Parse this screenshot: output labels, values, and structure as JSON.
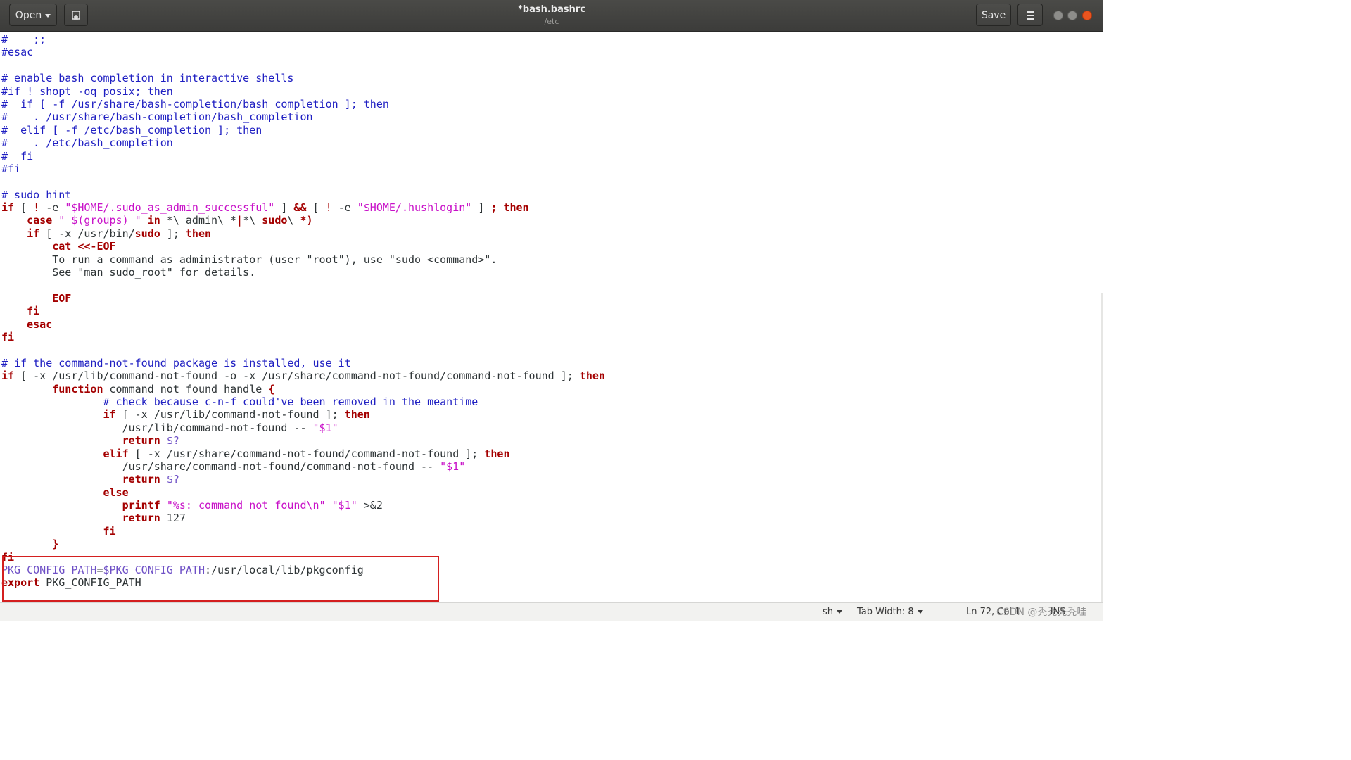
{
  "header": {
    "open_label": "Open",
    "new_icon": "new-document-icon",
    "title": "*bash.bashrc",
    "subtitle": "/etc",
    "save_label": "Save",
    "menu_icon": "hamburger-menu-icon"
  },
  "editor": {
    "language": "sh",
    "lines": [
      [
        [
          "c",
          "#    ;;"
        ]
      ],
      [
        [
          "c",
          "#esac"
        ]
      ],
      [
        [
          "p",
          ""
        ]
      ],
      [
        [
          "c",
          "# enable bash completion in interactive shells"
        ]
      ],
      [
        [
          "c",
          "#if ! shopt -oq posix; then"
        ]
      ],
      [
        [
          "c",
          "#  if [ -f /usr/share/bash-completion/bash_completion ]; then"
        ]
      ],
      [
        [
          "c",
          "#    . /usr/share/bash-completion/bash_completion"
        ]
      ],
      [
        [
          "c",
          "#  elif [ -f /etc/bash_completion ]; then"
        ]
      ],
      [
        [
          "c",
          "#    . /etc/bash_completion"
        ]
      ],
      [
        [
          "c",
          "#  fi"
        ]
      ],
      [
        [
          "c",
          "#fi"
        ]
      ],
      [
        [
          "p",
          ""
        ]
      ],
      [
        [
          "c",
          "# sudo hint"
        ]
      ],
      [
        [
          "k",
          "if"
        ],
        [
          "p",
          " [ "
        ],
        [
          "o",
          "!"
        ],
        [
          "p",
          " -e "
        ],
        [
          "s",
          "\"$HOME/.sudo_as_admin_successful\""
        ],
        [
          "p",
          " ] "
        ],
        [
          "k",
          "&&"
        ],
        [
          "p",
          " [ "
        ],
        [
          "o",
          "!"
        ],
        [
          "p",
          " -e "
        ],
        [
          "s",
          "\"$HOME/.hushlogin\""
        ],
        [
          "p",
          " ] "
        ],
        [
          "k",
          "; then"
        ]
      ],
      [
        [
          "p",
          "    "
        ],
        [
          "k",
          "case"
        ],
        [
          "p",
          " "
        ],
        [
          "s",
          "\" $(groups) \""
        ],
        [
          "p",
          " "
        ],
        [
          "k",
          "in"
        ],
        [
          "p",
          " *\\ admin\\ *"
        ],
        [
          "o",
          "|"
        ],
        [
          "p",
          "*\\ "
        ],
        [
          "k",
          "sudo"
        ],
        [
          "p",
          "\\ "
        ],
        [
          "k",
          "*)"
        ]
      ],
      [
        [
          "p",
          "    "
        ],
        [
          "k",
          "if"
        ],
        [
          "p",
          " [ -x /usr/bin/"
        ],
        [
          "k",
          "sudo"
        ],
        [
          "p",
          " ]; "
        ],
        [
          "k",
          "then"
        ]
      ],
      [
        [
          "p",
          "        "
        ],
        [
          "k",
          "cat <<-EOF"
        ]
      ],
      [
        [
          "p",
          "        To run a command as administrator (user \"root\"), use \"sudo <command>\"."
        ]
      ],
      [
        [
          "p",
          "        See \"man sudo_root\" for details."
        ]
      ],
      [
        [
          "p",
          ""
        ]
      ],
      [
        [
          "p",
          "        "
        ],
        [
          "k",
          "EOF"
        ]
      ],
      [
        [
          "p",
          "    "
        ],
        [
          "k",
          "fi"
        ]
      ],
      [
        [
          "p",
          "    "
        ],
        [
          "k",
          "esac"
        ]
      ],
      [
        [
          "k",
          "fi"
        ]
      ],
      [
        [
          "p",
          ""
        ]
      ],
      [
        [
          "c",
          "# if the command-not-found package is installed, use it"
        ]
      ],
      [
        [
          "k",
          "if"
        ],
        [
          "p",
          " [ -x /usr/lib/command-not-found -o -x /usr/share/command-not-found/command-not-found ]; "
        ],
        [
          "k",
          "then"
        ]
      ],
      [
        [
          "p",
          "        "
        ],
        [
          "k",
          "function"
        ],
        [
          "p",
          " command_not_found_handle "
        ],
        [
          "k",
          "{"
        ]
      ],
      [
        [
          "p",
          "                "
        ],
        [
          "c",
          "# check because c-n-f could've been removed in the meantime"
        ]
      ],
      [
        [
          "p",
          "                "
        ],
        [
          "k",
          "if"
        ],
        [
          "p",
          " [ -x /usr/lib/command-not-found ]; "
        ],
        [
          "k",
          "then"
        ]
      ],
      [
        [
          "p",
          "                   /usr/lib/command-not-found -- "
        ],
        [
          "s",
          "\"$1\""
        ]
      ],
      [
        [
          "p",
          "                   "
        ],
        [
          "k",
          "return"
        ],
        [
          "p",
          " "
        ],
        [
          "v",
          "$?"
        ]
      ],
      [
        [
          "p",
          "                "
        ],
        [
          "k",
          "elif"
        ],
        [
          "p",
          " [ -x /usr/share/command-not-found/command-not-found ]; "
        ],
        [
          "k",
          "then"
        ]
      ],
      [
        [
          "p",
          "                   /usr/share/command-not-found/command-not-found -- "
        ],
        [
          "s",
          "\"$1\""
        ]
      ],
      [
        [
          "p",
          "                   "
        ],
        [
          "k",
          "return"
        ],
        [
          "p",
          " "
        ],
        [
          "v",
          "$?"
        ]
      ],
      [
        [
          "p",
          "                "
        ],
        [
          "k",
          "else"
        ]
      ],
      [
        [
          "p",
          "                   "
        ],
        [
          "k",
          "printf"
        ],
        [
          "p",
          " "
        ],
        [
          "s",
          "\"%s: command not found\\n\""
        ],
        [
          "p",
          " "
        ],
        [
          "s",
          "\"$1\""
        ],
        [
          "p",
          " >&2"
        ]
      ],
      [
        [
          "p",
          "                   "
        ],
        [
          "k",
          "return"
        ],
        [
          "p",
          " 127"
        ]
      ],
      [
        [
          "p",
          "                "
        ],
        [
          "k",
          "fi"
        ]
      ],
      [
        [
          "p",
          "        "
        ],
        [
          "k",
          "}"
        ]
      ],
      [
        [
          "k",
          "fi"
        ]
      ],
      [
        [
          "v",
          "PKG_CONFIG_PATH"
        ],
        [
          "p",
          "="
        ],
        [
          "v",
          "$PKG_CONFIG_PATH"
        ],
        [
          "p",
          ":/usr/local/lib/pkgconfig"
        ]
      ],
      [
        [
          "k",
          "export"
        ],
        [
          "p",
          " PKG_CONFIG_PATH"
        ]
      ]
    ]
  },
  "statusbar": {
    "language_label": "sh",
    "tab_width_label": "Tab Width: 8",
    "position_label": "Ln 72, Col 1",
    "mode_label": "INS"
  },
  "watermark": "CSDN @秃秃秃秃哇"
}
